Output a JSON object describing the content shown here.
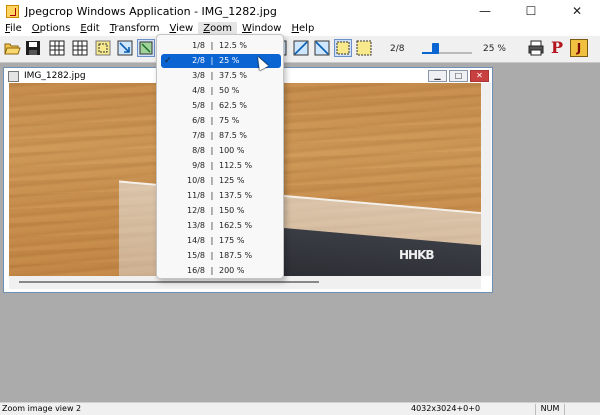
{
  "window": {
    "title": "Jpegcrop Windows Application - IMG_1282.jpg",
    "minimize": "—",
    "maximize": "☐",
    "close": "✕"
  },
  "menu": [
    {
      "label": "File",
      "ul": "F",
      "rest": "ile"
    },
    {
      "label": "Options",
      "ul": "O",
      "rest": "ptions"
    },
    {
      "label": "Edit",
      "ul": "E",
      "rest": "dit"
    },
    {
      "label": "Transform",
      "ul": "T",
      "rest": "ransform"
    },
    {
      "label": "View",
      "ul": "V",
      "rest": "iew"
    },
    {
      "label": "Zoom",
      "ul": "Z",
      "rest": "oom"
    },
    {
      "label": "Window",
      "ul": "W",
      "rest": "indow"
    },
    {
      "label": "Help",
      "ul": "H",
      "rest": "elp"
    }
  ],
  "toolbar": {
    "icons": [
      "open-folder-icon",
      "save-icon",
      "grid-icon",
      "grid-select-icon",
      "crop-select-icon",
      "arrow-in-icon",
      "crop-active-icon"
    ],
    "right_icons": [
      "crop-frame-icon",
      "arrow-diag-icon",
      "arrow-diag2-icon",
      "select-dotted-icon",
      "select-dotted2-icon"
    ],
    "zoom_fraction": "2/8",
    "zoom_percent": "25 %",
    "zoom_level": 0.25,
    "end_icons": [
      "printer-icon",
      "p-icon",
      "j-icon"
    ],
    "p_glyph": "P",
    "j_glyph": "J"
  },
  "child_window": {
    "title": "IMG_1282.jpg",
    "minimize": "▁",
    "maximize": "□",
    "close": "✕"
  },
  "photo": {
    "logo_text": "HHKB"
  },
  "zoom_menu": {
    "items": [
      {
        "frac": "1/8",
        "pct": "12.5 %"
      },
      {
        "frac": "2/8",
        "pct": "25 %",
        "checked": true,
        "selected": true
      },
      {
        "frac": "3/8",
        "pct": "37.5 %"
      },
      {
        "frac": "4/8",
        "pct": "50 %"
      },
      {
        "frac": "5/8",
        "pct": "62.5 %"
      },
      {
        "frac": "6/8",
        "pct": "75 %"
      },
      {
        "frac": "7/8",
        "pct": "87.5 %"
      },
      {
        "frac": "8/8",
        "pct": "100 %"
      },
      {
        "frac": "9/8",
        "pct": "112.5 %"
      },
      {
        "frac": "10/8",
        "pct": "125 %"
      },
      {
        "frac": "11/8",
        "pct": "137.5 %"
      },
      {
        "frac": "12/8",
        "pct": "150 %"
      },
      {
        "frac": "13/8",
        "pct": "162.5 %"
      },
      {
        "frac": "14/8",
        "pct": "175 %"
      },
      {
        "frac": "15/8",
        "pct": "187.5 %"
      },
      {
        "frac": "16/8",
        "pct": "200 %"
      }
    ],
    "separator": "|",
    "check_glyph": "✓"
  },
  "status": {
    "message": "Zoom image view 2",
    "coords": "4032x3024+0+0",
    "num": "NUM"
  },
  "colors": {
    "accent": "#0a64d2",
    "mdi_background": "#ababab"
  }
}
